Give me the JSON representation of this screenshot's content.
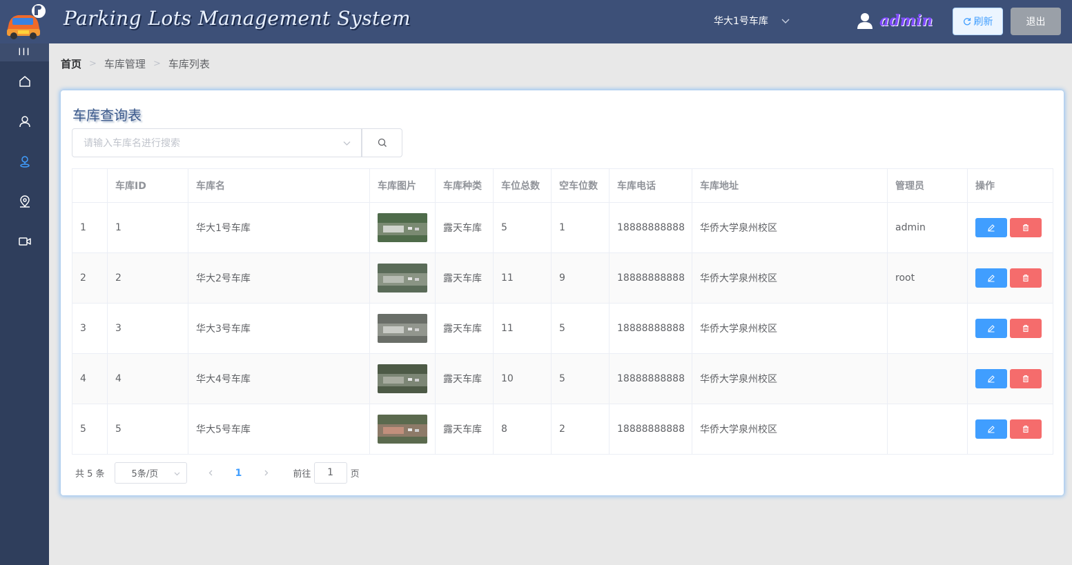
{
  "header": {
    "title": "Parking Lots Management System",
    "garage_selected": "华大1号车库",
    "user_name": "admin",
    "refresh_label": "刷新",
    "logout_label": "退出"
  },
  "sidebar": {
    "toggle_label": "III",
    "items": [
      {
        "icon": "home-icon",
        "active": false
      },
      {
        "icon": "user-icon",
        "active": false
      },
      {
        "icon": "map-pin-icon",
        "active": true
      },
      {
        "icon": "location-icon",
        "active": false
      },
      {
        "icon": "video-camera-icon",
        "active": false
      }
    ]
  },
  "breadcrumb": [
    "首页",
    "车库管理",
    "车库列表"
  ],
  "card": {
    "title": "车库查询表",
    "search_placeholder": "请输入车库名进行搜索"
  },
  "table": {
    "columns": [
      "",
      "车库ID",
      "车库名",
      "车库图片",
      "车库种类",
      "车位总数",
      "空车位数",
      "车库电话",
      "车库地址",
      "管理员",
      "操作"
    ],
    "rows": [
      {
        "index": "1",
        "id": "1",
        "name": "华大1号车库",
        "type": "露天车库",
        "total": "5",
        "free": "1",
        "phone": "18888888888",
        "address": "华侨大学泉州校区",
        "admin": "admin"
      },
      {
        "index": "2",
        "id": "2",
        "name": "华大2号车库",
        "type": "露天车库",
        "total": "11",
        "free": "9",
        "phone": "18888888888",
        "address": "华侨大学泉州校区",
        "admin": "root"
      },
      {
        "index": "3",
        "id": "3",
        "name": "华大3号车库",
        "type": "露天车库",
        "total": "11",
        "free": "5",
        "phone": "18888888888",
        "address": "华侨大学泉州校区",
        "admin": ""
      },
      {
        "index": "4",
        "id": "4",
        "name": "华大4号车库",
        "type": "露天车库",
        "total": "10",
        "free": "5",
        "phone": "18888888888",
        "address": "华侨大学泉州校区",
        "admin": ""
      },
      {
        "index": "5",
        "id": "5",
        "name": "华大5号车库",
        "type": "露天车库",
        "total": "8",
        "free": "2",
        "phone": "18888888888",
        "address": "华侨大学泉州校区",
        "admin": ""
      }
    ]
  },
  "pagination": {
    "total_label": "共 5 条",
    "page_size": "5条/页",
    "current_page": "1",
    "goto_label": "前往",
    "goto_value": "1",
    "goto_suffix": "页"
  },
  "colors": {
    "header_bg": "#3d5078",
    "sidebar_bg": "#2f3e5c",
    "primary": "#409eff",
    "danger": "#f56c6c"
  }
}
